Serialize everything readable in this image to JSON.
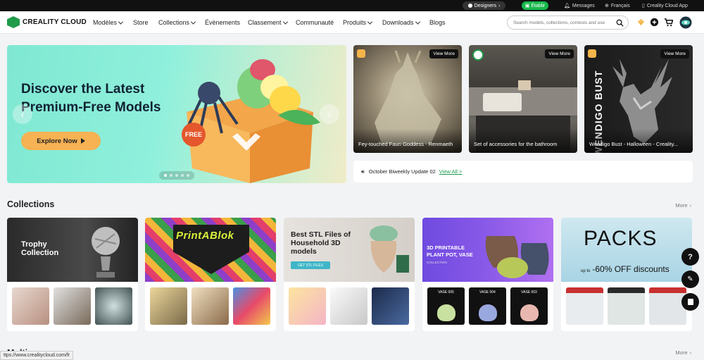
{
  "topbar": {
    "designers": "Designers",
    "etablir": "Établir",
    "messages": "Messages",
    "language": "Français",
    "app": "Creality Cloud App"
  },
  "nav": {
    "brand": "CREALITY CLOUD",
    "items": [
      "Modèles",
      "Store",
      "Collections",
      "Évènements",
      "Classement",
      "Communauté",
      "Produits",
      "Downloads",
      "Blogs"
    ],
    "search_placeholder": "Search models, collections, contests and use"
  },
  "hero": {
    "title": "Discover the Latest Premium-Free Models",
    "button": "Explore Now",
    "free_tag": "FREE"
  },
  "featured": [
    {
      "title": "Fey-touched Faun Goddess - Renmaeth",
      "view": "View More"
    },
    {
      "title": "Set of accessories for the bathroom",
      "view": "View More"
    },
    {
      "title": "Wendigo Bust - Halloween - Creality...",
      "view": "View More",
      "side_text": "WENDIGO BUST"
    }
  ],
  "announcement": {
    "text": "October Biweekly Update 02",
    "link": "View All >"
  },
  "collections": {
    "title": "Collections",
    "more": "More",
    "cards": [
      {
        "banner": "Trophy Collection"
      },
      {
        "banner": "PrintABlok"
      },
      {
        "banner": "Best STL Files of Household 3D models",
        "cta": "GET STL FILES"
      },
      {
        "banner": "3D PRINTABLE PLANT POT, VASE",
        "sub": "COLLECTION",
        "thumbs": [
          "VASE 005",
          "VASE 004",
          "VASE 003"
        ]
      },
      {
        "banner": "PACKS",
        "sub_prefix": "up to",
        "sub": "-60% OFF discounts"
      }
    ]
  },
  "next_section": {
    "title": "Multi...",
    "more": "More"
  },
  "status_url": "ttps://www.crealitycloud.com/fr",
  "colors": {
    "brand_green": "#1f9b4a",
    "accent_orange": "#f6b253",
    "etablir_green": "#17b84b"
  }
}
